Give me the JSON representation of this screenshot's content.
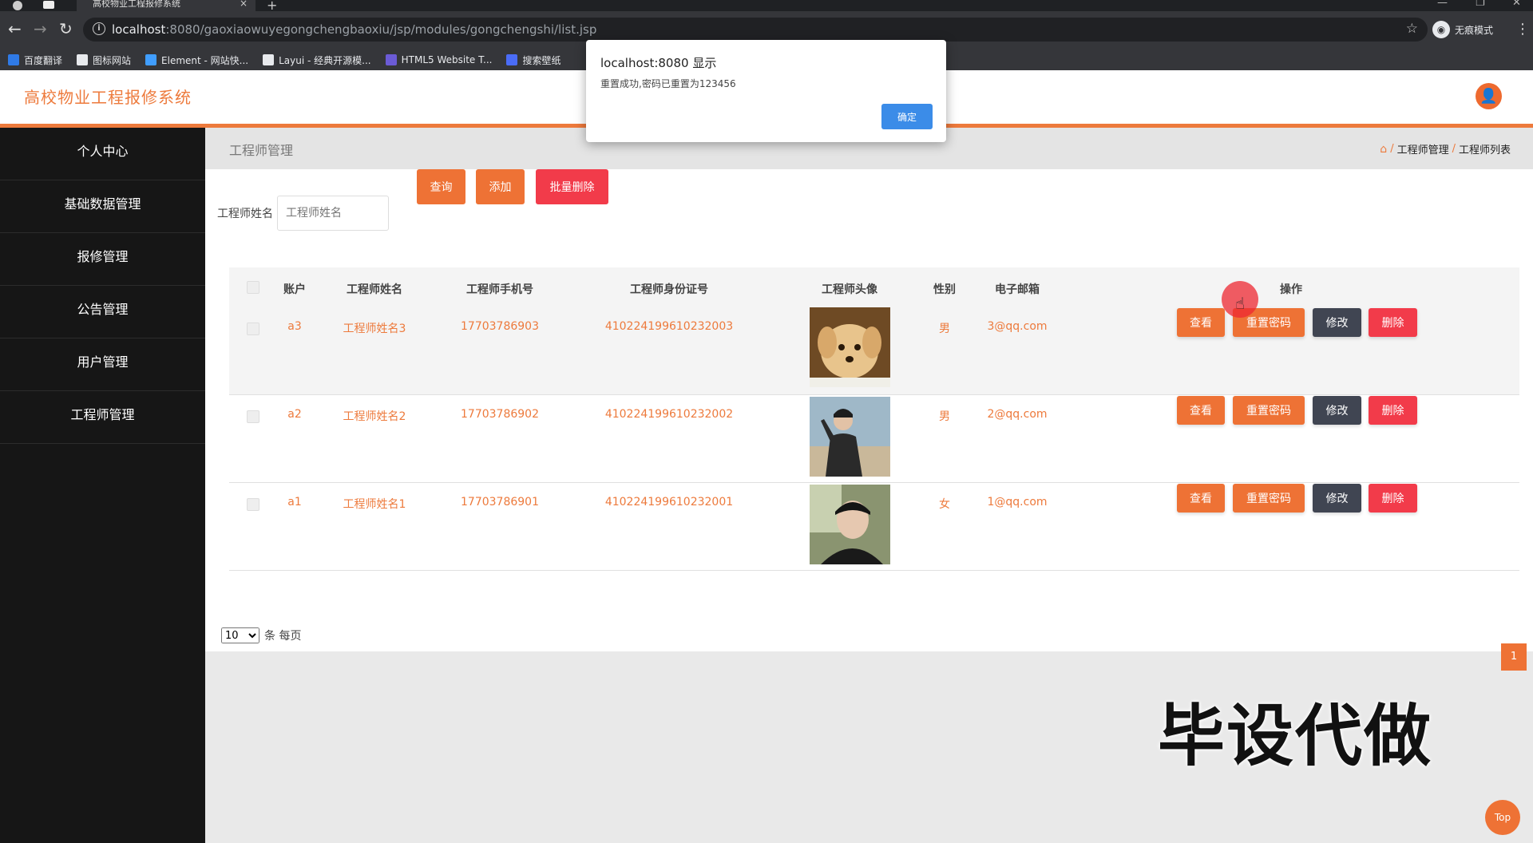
{
  "browser": {
    "tab_title": "高校物业工程报修系统",
    "url_host": "localhost",
    "url_rest": ":8080/gaoxiaowuyegongchengbaoxiu/jsp/modules/gongchengshi/list.jsp",
    "incognito_label": "无痕模式",
    "bookmarks": [
      {
        "label": "百度翻译",
        "color": "#2f7ae6"
      },
      {
        "label": "图标网站",
        "color": "#e8eaed"
      },
      {
        "label": "Element - 网站快...",
        "color": "#409eff"
      },
      {
        "label": "Layui - 经典开源模...",
        "color": "#e8eaed"
      },
      {
        "label": "HTML5 Website T...",
        "color": "#6b5bd6"
      },
      {
        "label": "搜索壁纸",
        "color": "#4a6cf7"
      }
    ]
  },
  "app": {
    "title": "高校物业工程报修系统",
    "accent": "#ed7a3c"
  },
  "sidebar": {
    "items": [
      "个人中心",
      "基础数据管理",
      "报修管理",
      "公告管理",
      "用户管理",
      "工程师管理"
    ]
  },
  "page": {
    "heading": "工程师管理",
    "breadcrumb": [
      "工程师管理",
      "工程师列表"
    ]
  },
  "search": {
    "label": "工程师姓名",
    "placeholder": "工程师姓名",
    "query_label": "查询",
    "add_label": "添加",
    "batch_delete_label": "批量删除"
  },
  "table": {
    "headers": [
      "账户",
      "工程师姓名",
      "工程师手机号",
      "工程师身份证号",
      "工程师头像",
      "性别",
      "电子邮箱",
      "操作"
    ],
    "rows": [
      {
        "account": "a3",
        "name": "工程师姓名3",
        "phone": "17703786903",
        "id_card": "410224199610232003",
        "gender": "男",
        "email": "3@qq.com"
      },
      {
        "account": "a2",
        "name": "工程师姓名2",
        "phone": "17703786902",
        "id_card": "410224199610232002",
        "gender": "男",
        "email": "2@qq.com"
      },
      {
        "account": "a1",
        "name": "工程师姓名1",
        "phone": "17703786901",
        "id_card": "410224199610232001",
        "gender": "女",
        "email": "1@qq.com"
      }
    ],
    "actions": {
      "view": "查看",
      "reset": "重置密码",
      "edit": "修改",
      "delete": "删除"
    }
  },
  "pagination": {
    "page_size": "10",
    "page_size_suffix": "条 每页",
    "current_page": "1"
  },
  "alert": {
    "title": "localhost:8080 显示",
    "message": "重置成功,密码已重置为123456",
    "ok_label": "确定"
  },
  "overlay": {
    "watermark": "毕设代做",
    "top_label": "Top"
  }
}
